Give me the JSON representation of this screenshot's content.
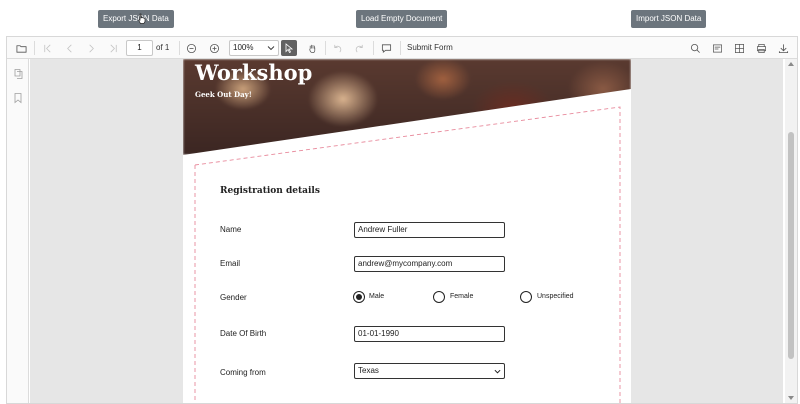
{
  "top_buttons": {
    "export_label": "Export JSON Data",
    "load_empty_label": "Load Empty Document",
    "import_label": "Import JSON Data"
  },
  "toolbar": {
    "current_page": "1",
    "page_of": "of 1",
    "zoom": "100%",
    "submit_label": "Submit Form",
    "icons": [
      "open-icon",
      "first-page-icon",
      "previous-page-icon",
      "next-page-icon",
      "last-page-icon",
      "zoom-out-icon",
      "zoom-in-icon",
      "selection-tool-icon",
      "pan-tool-icon",
      "undo-icon",
      "redo-icon",
      "comment-icon",
      "search-icon",
      "annotation-icon",
      "form-designer-icon",
      "print-icon",
      "download-icon"
    ]
  },
  "left_nav": {
    "icons": [
      "page-thumbnails-icon",
      "bookmark-icon"
    ]
  },
  "document": {
    "banner_title": "Workshop",
    "banner_subtitle": "Geek Out Day!",
    "form_title": "Registration details",
    "fields": {
      "name_label": "Name",
      "name_value": "Andrew Fuller",
      "email_label": "Email",
      "email_value": "andrew@mycompany.com",
      "gender_label": "Gender",
      "gender_options": [
        "Male",
        "Female",
        "Unspecified"
      ],
      "gender_selected": "Male",
      "dob_label": "Date Of Birth",
      "dob_value": "01-01-1990",
      "coming_from_label": "Coming from",
      "coming_from_value": "Texas"
    }
  },
  "colors": {
    "button_bg": "#6c757d",
    "toolbar_bg": "#fafafa",
    "doc_bg": "#e6e6e6",
    "dash_color": "#e88a9c",
    "active_tool_bg": "#616161"
  }
}
